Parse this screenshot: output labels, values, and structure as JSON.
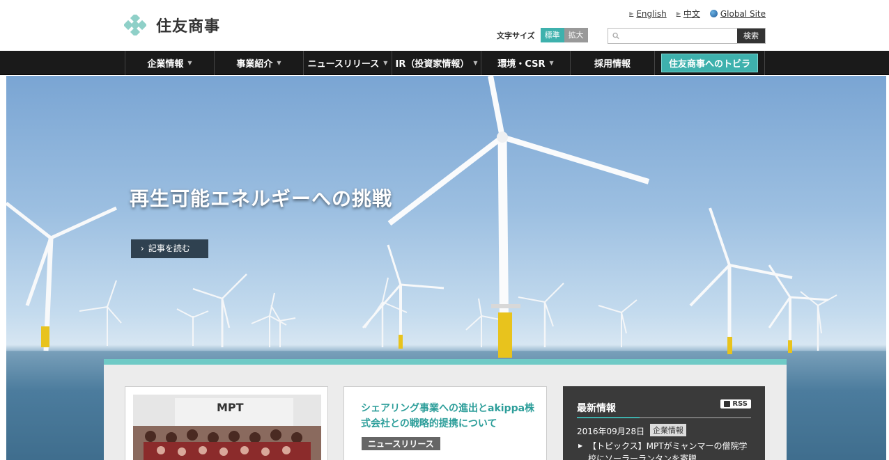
{
  "header": {
    "logo_text": "住友商事",
    "toplinks": [
      {
        "label": "English"
      },
      {
        "label": "中文"
      },
      {
        "label": "Global Site"
      }
    ],
    "font_size": {
      "label": "文字サイズ",
      "standard": "標準",
      "large": "拡大"
    },
    "search": {
      "placeholder": "",
      "button": "検索"
    }
  },
  "nav": {
    "items": [
      {
        "label": "企業情報"
      },
      {
        "label": "事業紹介"
      },
      {
        "label": "ニュースリリース"
      },
      {
        "label": "IR（投資家情報）"
      },
      {
        "label": "環境・CSR"
      },
      {
        "label": "採用情報"
      }
    ],
    "cta": "住友商事へのトビラ"
  },
  "hero": {
    "title": "再生可能エネルギーへの挑戦",
    "button": "記事を読む"
  },
  "cards": {
    "feature": {
      "title": "シェアリング事業への進出とakippa株式会社との戦略的提携について",
      "tag": "ニュースリリース"
    },
    "latest": {
      "heading": "最新情報",
      "rss": "RSS",
      "date": "2016年09月28日",
      "category": "企業情報",
      "item": "【トピックス】MPTがミャンマーの僧院学校にソーラーランタンを寄贈"
    }
  },
  "colors": {
    "accent": "#3eb1ad",
    "nav_bg": "#1a1a1a",
    "latest_bg": "#3a3a3a",
    "title_teal": "#2d9e9a"
  }
}
